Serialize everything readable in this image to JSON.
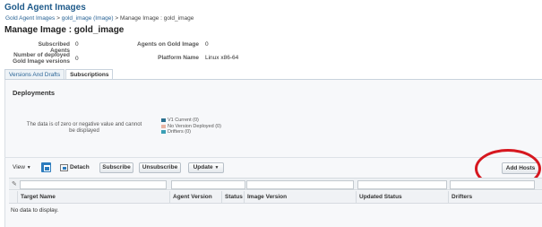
{
  "app_title": "Gold Agent Images",
  "breadcrumb": {
    "items": [
      "Gold Agent Images",
      "gold_image (Image)",
      "Manage Image : gold_image"
    ],
    "separator": ">"
  },
  "page_title": "Manage Image : gold_image",
  "info": {
    "subscribed_agents_label": "Subscribed Agents",
    "subscribed_agents_value": "0",
    "deployed_versions_label": "Number of deployed Gold Image versions",
    "deployed_versions_value": "0",
    "agents_on_gold_image_label": "Agents on Gold Image",
    "agents_on_gold_image_value": "0",
    "platform_name_label": "Platform Name",
    "platform_name_value": "Linux x86-64"
  },
  "tabs": [
    {
      "label": "Versions And Drafts",
      "active": false
    },
    {
      "label": "Subscriptions",
      "active": true
    }
  ],
  "deployments": {
    "title": "Deployments",
    "chart_message": "The data is of zero or negative value and cannot be displayed",
    "legend": [
      {
        "label": "V1 Current (0)",
        "color": "#2a6f8f"
      },
      {
        "label": "No Version Deployed (0)",
        "color": "#e8b4a3"
      },
      {
        "label": "Drifters (0)",
        "color": "#3a9fb5"
      }
    ]
  },
  "toolbar": {
    "view_label": "View",
    "view_arrow": "▼",
    "detach_label": "Detach",
    "subscribe_label": "Subscribe",
    "unsubscribe_label": "Unsubscribe",
    "update_label": "Update",
    "update_arrow": "▼",
    "add_hosts_label": "Add Hosts"
  },
  "table": {
    "columns": [
      "Target Name",
      "Agent Version",
      "Status",
      "Image Version",
      "Updated Status",
      "Drifters"
    ],
    "empty_message": "No data to display."
  },
  "colors": {
    "title_blue": "#1e5a8a",
    "link_blue": "#2a6496",
    "annotation_red": "#d6171f"
  }
}
